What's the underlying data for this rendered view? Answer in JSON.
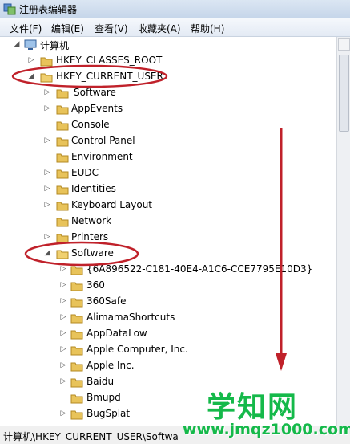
{
  "window": {
    "title": "注册表编辑器"
  },
  "menu": [
    "文件(F)",
    "编辑(E)",
    "查看(V)",
    "收藏夹(A)",
    "帮助(H)"
  ],
  "tree": {
    "root": "计算机",
    "items": [
      {
        "label": "HKEY_CLASSES_ROOT"
      },
      {
        "label": "HKEY_CURRENT_USER"
      },
      {
        "label": "Software"
      },
      {
        "label": "AppEvents"
      },
      {
        "label": "Console"
      },
      {
        "label": "Control Panel"
      },
      {
        "label": "Environment"
      },
      {
        "label": "EUDC"
      },
      {
        "label": "Identities"
      },
      {
        "label": "Keyboard Layout"
      },
      {
        "label": "Network"
      },
      {
        "label": "Printers"
      },
      {
        "label": "Software"
      },
      {
        "label": "{6A896522-C181-40E4-A1C6-CCE7795E10D3}"
      },
      {
        "label": "360"
      },
      {
        "label": "360Safe"
      },
      {
        "label": "AlimamaShortcuts"
      },
      {
        "label": "AppDataLow"
      },
      {
        "label": "Apple Computer, Inc."
      },
      {
        "label": "Apple Inc."
      },
      {
        "label": "Baidu"
      },
      {
        "label": "Bmupd"
      },
      {
        "label": "BugSplat"
      }
    ]
  },
  "status": {
    "path": "计算机\\HKEY_CURRENT_USER\\Softwa"
  },
  "watermark": {
    "main": "学知网",
    "url": "www.jmqz1000.com"
  },
  "colors": {
    "annotation": "#c0212a",
    "watermark": "#15b94a",
    "folder": "#e8c35a"
  }
}
